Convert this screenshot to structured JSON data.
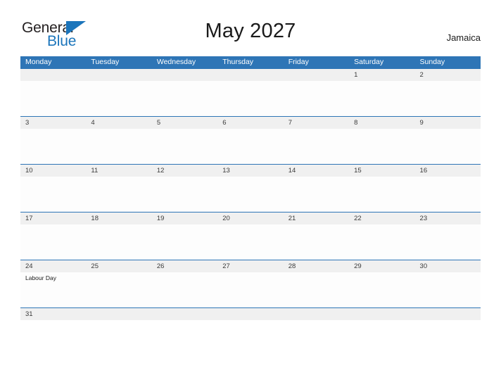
{
  "brand": {
    "name_part1": "General",
    "name_part2": "Blue",
    "accent_color": "#1b75bb"
  },
  "header": {
    "title": "May 2027",
    "region": "Jamaica"
  },
  "theme": {
    "header_blue": "#2e75b6",
    "date_band_gray": "#f0f0f0",
    "text_dark": "#1a1a1a"
  },
  "calendar": {
    "weekdays": [
      "Monday",
      "Tuesday",
      "Wednesday",
      "Thursday",
      "Friday",
      "Saturday",
      "Sunday"
    ],
    "weeks": [
      {
        "days": [
          {
            "date": "",
            "event": ""
          },
          {
            "date": "",
            "event": ""
          },
          {
            "date": "",
            "event": ""
          },
          {
            "date": "",
            "event": ""
          },
          {
            "date": "",
            "event": ""
          },
          {
            "date": "1",
            "event": ""
          },
          {
            "date": "2",
            "event": ""
          }
        ]
      },
      {
        "days": [
          {
            "date": "3",
            "event": ""
          },
          {
            "date": "4",
            "event": ""
          },
          {
            "date": "5",
            "event": ""
          },
          {
            "date": "6",
            "event": ""
          },
          {
            "date": "7",
            "event": ""
          },
          {
            "date": "8",
            "event": ""
          },
          {
            "date": "9",
            "event": ""
          }
        ]
      },
      {
        "days": [
          {
            "date": "10",
            "event": ""
          },
          {
            "date": "11",
            "event": ""
          },
          {
            "date": "12",
            "event": ""
          },
          {
            "date": "13",
            "event": ""
          },
          {
            "date": "14",
            "event": ""
          },
          {
            "date": "15",
            "event": ""
          },
          {
            "date": "16",
            "event": ""
          }
        ]
      },
      {
        "days": [
          {
            "date": "17",
            "event": ""
          },
          {
            "date": "18",
            "event": ""
          },
          {
            "date": "19",
            "event": ""
          },
          {
            "date": "20",
            "event": ""
          },
          {
            "date": "21",
            "event": ""
          },
          {
            "date": "22",
            "event": ""
          },
          {
            "date": "23",
            "event": ""
          }
        ]
      },
      {
        "days": [
          {
            "date": "24",
            "event": "Labour Day"
          },
          {
            "date": "25",
            "event": ""
          },
          {
            "date": "26",
            "event": ""
          },
          {
            "date": "27",
            "event": ""
          },
          {
            "date": "28",
            "event": ""
          },
          {
            "date": "29",
            "event": ""
          },
          {
            "date": "30",
            "event": ""
          }
        ]
      },
      {
        "last": true,
        "days": [
          {
            "date": "31",
            "event": ""
          },
          {
            "date": "",
            "event": ""
          },
          {
            "date": "",
            "event": ""
          },
          {
            "date": "",
            "event": ""
          },
          {
            "date": "",
            "event": ""
          },
          {
            "date": "",
            "event": ""
          },
          {
            "date": "",
            "event": ""
          }
        ]
      }
    ]
  }
}
